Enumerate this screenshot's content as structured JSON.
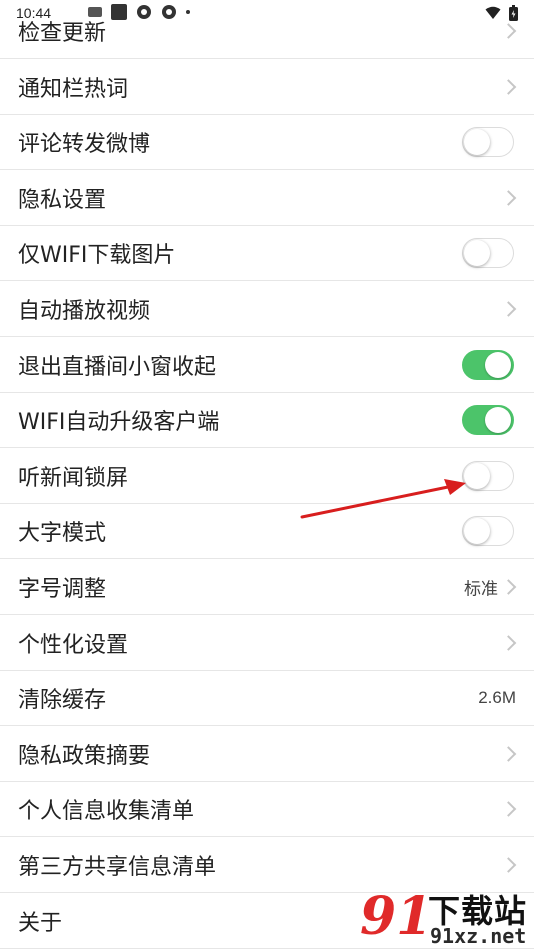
{
  "status_bar": {
    "time": "10:44"
  },
  "settings": [
    {
      "label": "检查更新",
      "control": "chevron"
    },
    {
      "label": "通知栏热词",
      "control": "chevron"
    },
    {
      "label": "评论转发微博",
      "control": "toggle",
      "on": false
    },
    {
      "label": "隐私设置",
      "control": "chevron"
    },
    {
      "label": "仅WIFI下载图片",
      "control": "toggle",
      "on": false
    },
    {
      "label": "自动播放视频",
      "control": "chevron"
    },
    {
      "label": "退出直播间小窗收起",
      "control": "toggle",
      "on": true
    },
    {
      "label": "WIFI自动升级客户端",
      "control": "toggle",
      "on": true
    },
    {
      "label": "听新闻锁屏",
      "control": "toggle",
      "on": false
    },
    {
      "label": "大字模式",
      "control": "toggle",
      "on": false
    },
    {
      "label": "字号调整",
      "control": "value-chevron",
      "value": "标准"
    },
    {
      "label": "个性化设置",
      "control": "chevron"
    },
    {
      "label": "清除缓存",
      "control": "value",
      "value": "2.6M"
    },
    {
      "label": "隐私政策摘要",
      "control": "chevron"
    },
    {
      "label": "个人信息收集清单",
      "control": "chevron"
    },
    {
      "label": "第三方共享信息清单",
      "control": "chevron"
    },
    {
      "label": "关于",
      "control": "none"
    }
  ],
  "colors": {
    "toggle_on": "#4cc46a",
    "arrow": "#d81e1e",
    "watermark": "#e02a2a"
  },
  "watermark": {
    "logo": "91",
    "title": "下载站",
    "domain": "91xz.net"
  }
}
